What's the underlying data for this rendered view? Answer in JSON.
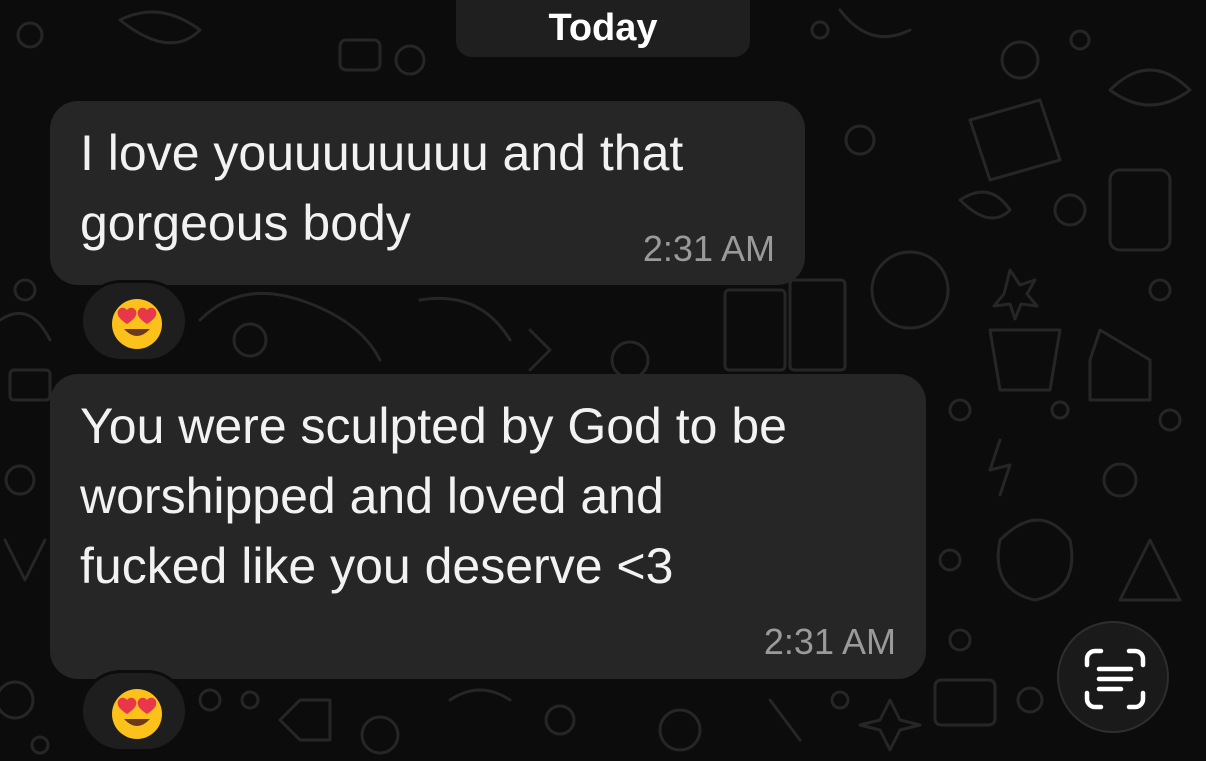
{
  "date_separator": "Today",
  "messages": [
    {
      "lines": [
        "I love youuuuuuuu and that",
        "gorgeous body"
      ],
      "time": "2:31 AM",
      "reaction": "😍"
    },
    {
      "lines": [
        "You were sculpted by God to be",
        "worshipped and loved and",
        "fucked like you deserve <3"
      ],
      "time": "2:31 AM",
      "reaction": "😍"
    }
  ],
  "icons": {
    "reaction_emoji": "heart-eyes-emoji-icon",
    "live_text_button": "live-text-scan-icon",
    "background": "doodle-pattern"
  },
  "colors": {
    "background": "#0c0c0c",
    "bubble": "#262626",
    "date_pill": "#1f1f1f",
    "text": "#f2f2f2",
    "timestamp": "#9a9a9a"
  }
}
